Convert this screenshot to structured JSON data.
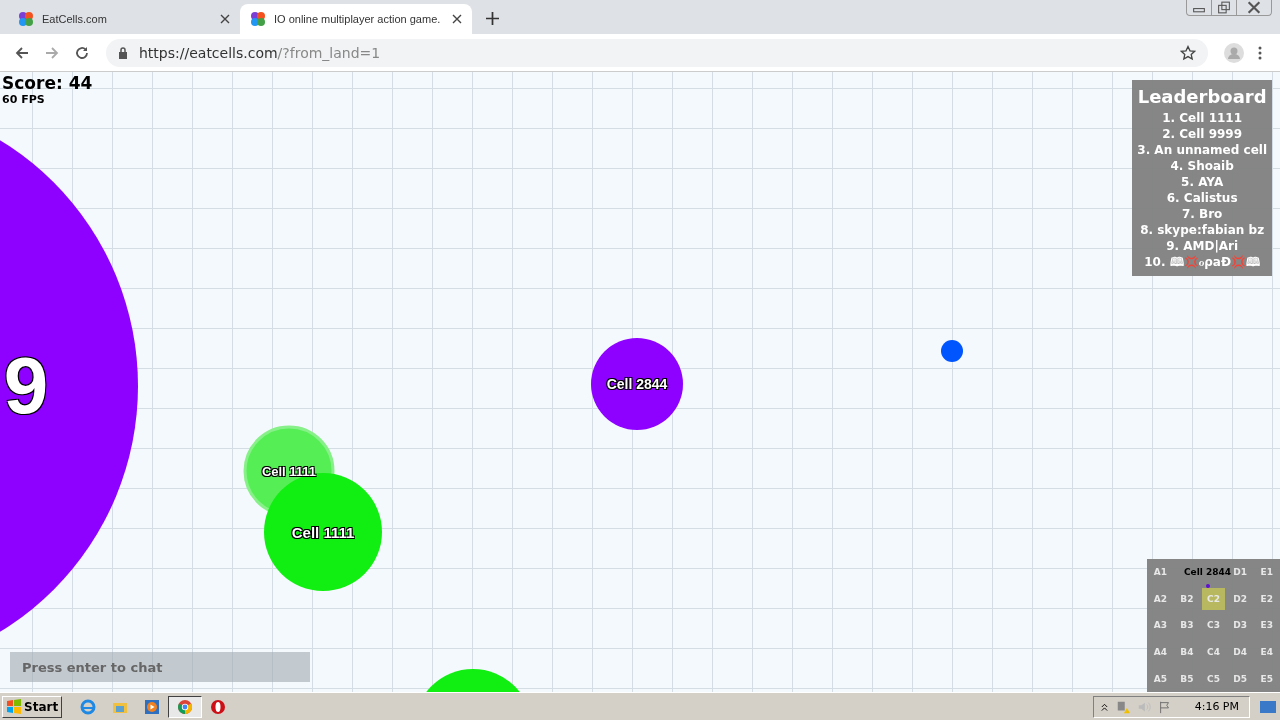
{
  "tabs": [
    {
      "title": "EatCells.com",
      "selected": false
    },
    {
      "title": "IO online multiplayer action game.",
      "selected": true
    }
  ],
  "address_bar": {
    "url_host": "https://eatcells.com",
    "url_path": "/?from_land=1"
  },
  "hud": {
    "score": "Score: 44",
    "fps": "60 FPS"
  },
  "cells": [
    {
      "label": "9",
      "color": "#8e00ff",
      "faded": false
    },
    {
      "label": "Cell 2844",
      "color": "#8e00ff",
      "faded": false
    },
    {
      "label": "Cell 1111",
      "color": "#55ee55",
      "faded": true
    },
    {
      "label": "Cell 1111",
      "color": "#11ee11",
      "faded": false
    },
    {
      "color": "#11ee11",
      "faded": false
    },
    {
      "color": "#0055ff",
      "faded": false
    }
  ],
  "leaderboard": {
    "title": "Leaderboard",
    "entries": [
      "1. Cell 1111",
      "2. Cell 9999",
      "3. An unnamed cell",
      "4. Shoaib",
      "5. AYA",
      "6. Calistus",
      "7. Bro",
      "8. skype:fabian bz",
      "9. AMD|Ari",
      "10. 🕮💢ℴρaÐ💢🕮"
    ]
  },
  "minimap": {
    "player_label": "Cell 2844",
    "cells": [
      {
        "label": "A1",
        "selected": false
      },
      {
        "selected": false
      },
      {
        "selected": false
      },
      {
        "label": "D1",
        "selected": false
      },
      {
        "label": "E1",
        "selected": false
      },
      {
        "label": "A2",
        "selected": false
      },
      {
        "label": "B2",
        "selected": false
      },
      {
        "label": "C2",
        "selected": true
      },
      {
        "label": "D2",
        "selected": false
      },
      {
        "label": "E2",
        "selected": false
      },
      {
        "label": "A3",
        "selected": false
      },
      {
        "label": "B3",
        "selected": false
      },
      {
        "label": "C3",
        "selected": false
      },
      {
        "label": "D3",
        "selected": false
      },
      {
        "label": "E3",
        "selected": false
      },
      {
        "label": "A4",
        "selected": false
      },
      {
        "label": "B4",
        "selected": false
      },
      {
        "label": "C4",
        "selected": false
      },
      {
        "label": "D4",
        "selected": false
      },
      {
        "label": "E4",
        "selected": false
      },
      {
        "label": "A5",
        "selected": false
      },
      {
        "label": "B5",
        "selected": false
      },
      {
        "label": "C5",
        "selected": false
      },
      {
        "label": "D5",
        "selected": false
      },
      {
        "label": "E5",
        "selected": false
      }
    ]
  },
  "chat": {
    "placeholder": "Press enter to chat"
  },
  "taskbar": {
    "start": "Start",
    "clock": "4:16 PM"
  }
}
